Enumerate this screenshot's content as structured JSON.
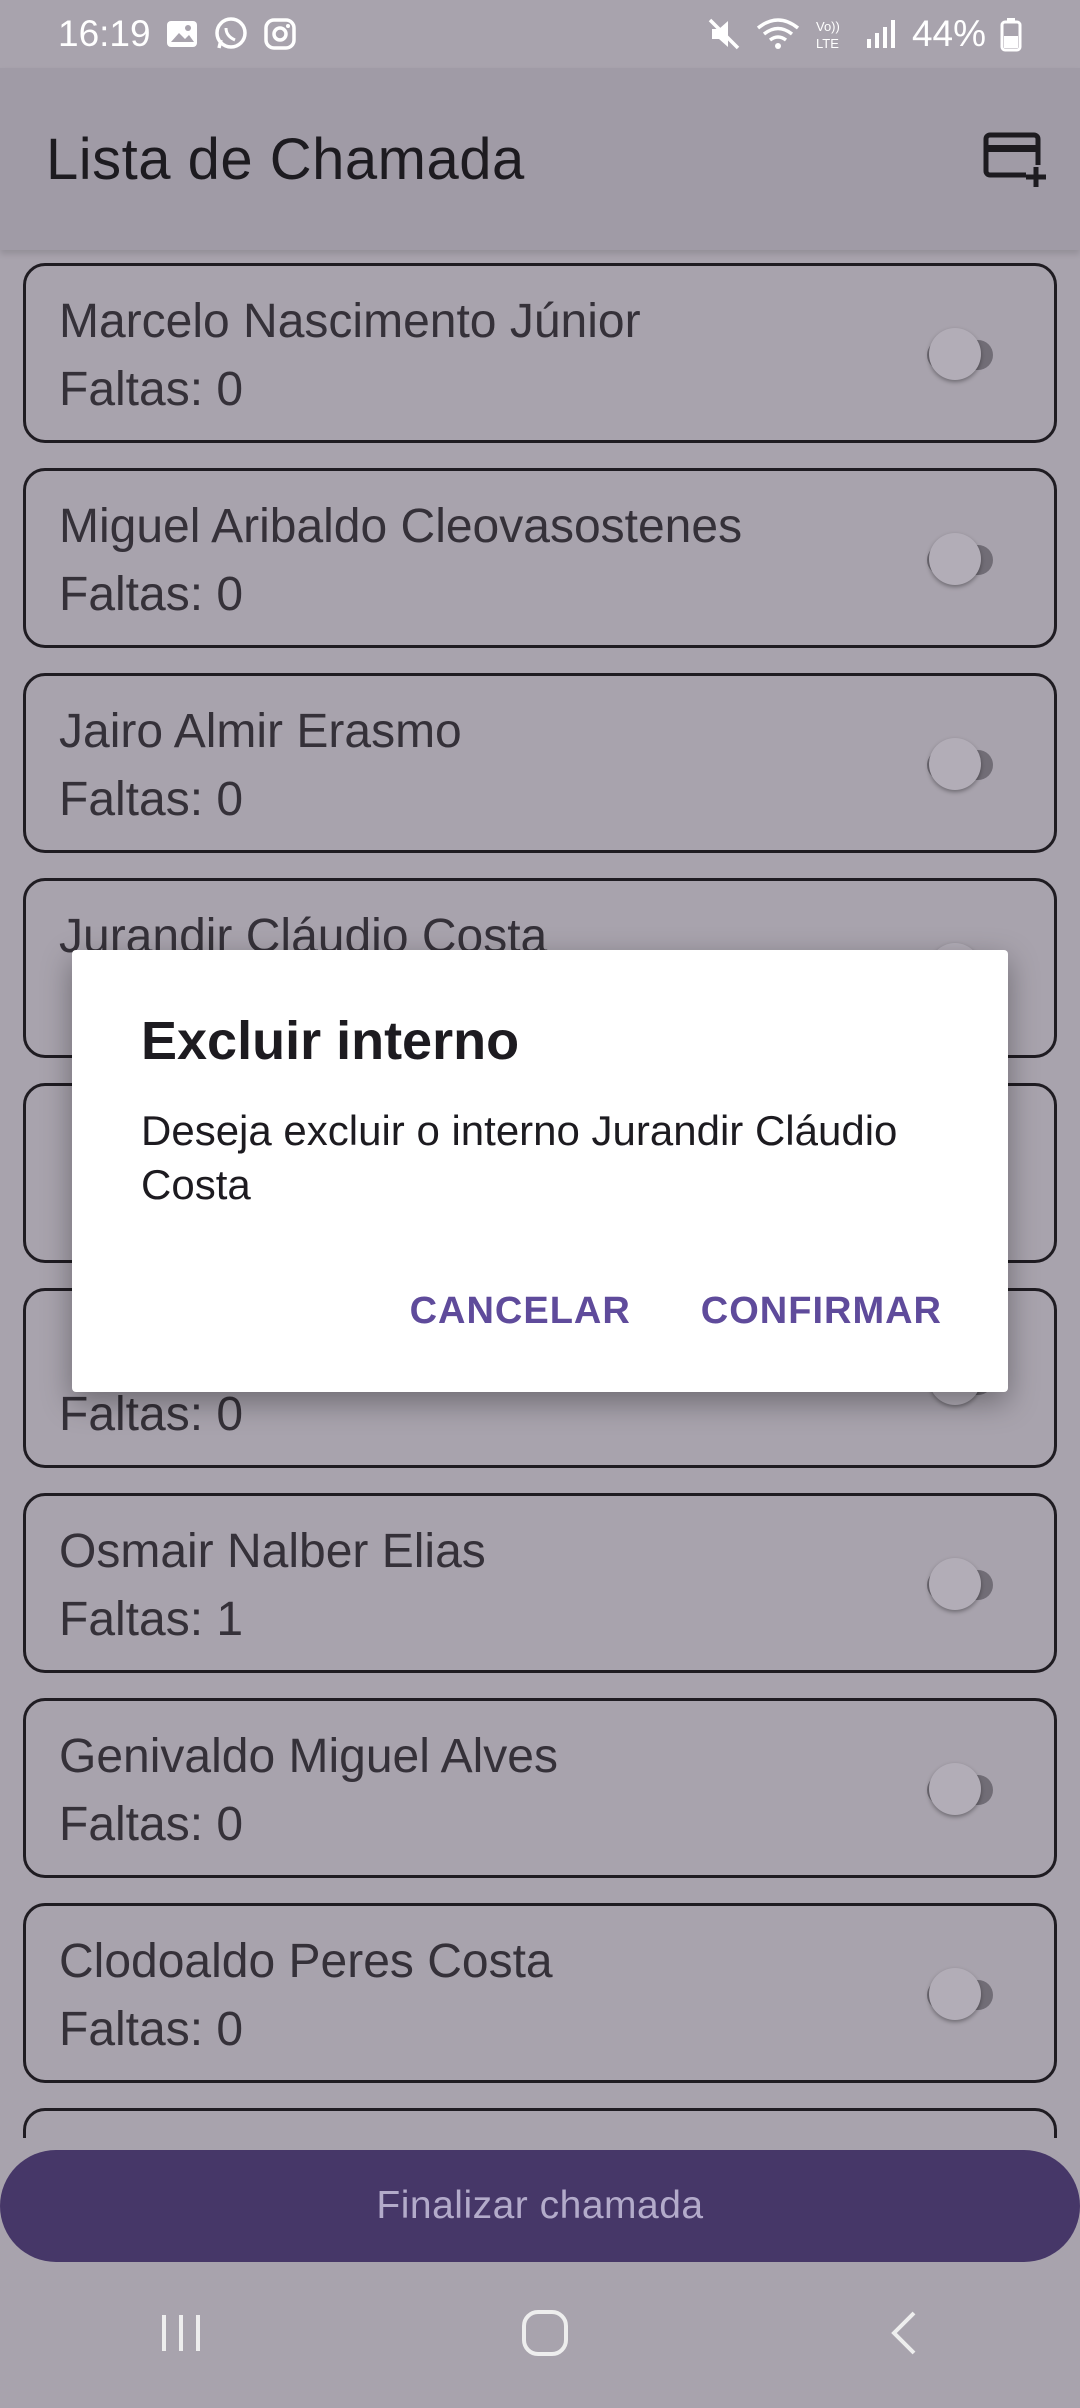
{
  "status_bar": {
    "time": "16:19",
    "battery": "44%",
    "left_icons": [
      "image-icon",
      "whatsapp-icon",
      "instagram-icon"
    ],
    "right_icons": [
      "mute-icon",
      "wifi-icon",
      "volte-icon",
      "signal-icon",
      "battery-icon"
    ]
  },
  "app_bar": {
    "title": "Lista de Chamada",
    "action_icon": "add-card-icon"
  },
  "students": [
    {
      "name": "Marcelo Nascimento Júnior",
      "faltas": "Faltas: 0",
      "present": false
    },
    {
      "name": "Miguel Aribaldo Cleovasostenes",
      "faltas": "Faltas: 0",
      "present": false
    },
    {
      "name": "Jairo Almir Erasmo",
      "faltas": "Faltas: 0",
      "present": false
    },
    {
      "name": "Jurandir Cláudio Costa",
      "faltas": "",
      "present": false
    },
    {
      "name": "",
      "faltas": "",
      "present": false
    },
    {
      "name": "",
      "faltas": "Faltas: 0",
      "present": false
    },
    {
      "name": "Osmair Nalber Elias",
      "faltas": "Faltas: 1",
      "present": false
    },
    {
      "name": "Genivaldo Miguel Alves",
      "faltas": "Faltas: 0",
      "present": false
    },
    {
      "name": "Clodoaldo Peres Costa",
      "faltas": "Faltas: 0",
      "present": false
    }
  ],
  "finish_button": {
    "label": "Finalizar chamada"
  },
  "dialog": {
    "title": "Excluir interno",
    "message": "Deseja excluir o interno Jurandir Cláudio Costa",
    "cancel_label": "CANCELAR",
    "confirm_label": "CONFIRMAR"
  },
  "nav_bar": {
    "icons": [
      "recent-apps-icon",
      "home-icon",
      "back-icon"
    ]
  },
  "colors": {
    "primary": "#463768",
    "dialog_action": "#5f4b9b",
    "scrim_background": "#a8a3ad"
  }
}
